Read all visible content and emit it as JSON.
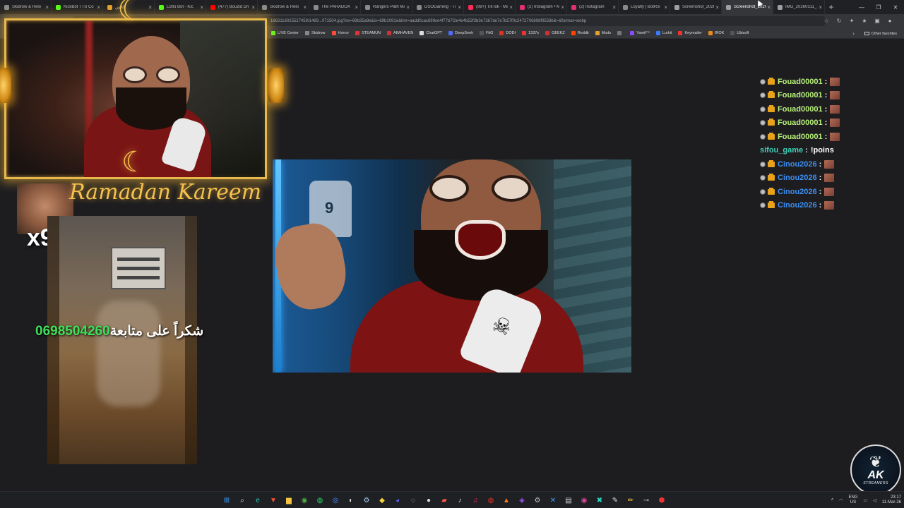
{
  "browser": {
    "tabs": [
      {
        "label": "Skidrow & Relo",
        "color": "#8a8a8a",
        "active": false
      },
      {
        "label": "KickBot TTS Co",
        "color": "#53fc18",
        "active": false
      },
      {
        "label": "كلاس",
        "color": "#e2a12b",
        "active": false
      },
      {
        "label": "Lotto Bot - Kic",
        "color": "#53fc18",
        "active": false
      },
      {
        "label": "(477) Bouzid Dri",
        "color": "#ff0000",
        "active": false
      },
      {
        "label": "Skidrow & Relo",
        "color": "#8a8a8a",
        "active": false
      },
      {
        "label": "The PARADOX",
        "color": "#8a8a8a",
        "active": false
      },
      {
        "label": "Rangers Path Ma",
        "color": "#8a8a8a",
        "active": false
      },
      {
        "label": "DSOGaming - Ti",
        "color": "#8a8a8a",
        "active": false
      },
      {
        "label": "(99+) TikTok - Ma",
        "color": "#ff2a55",
        "active": false
      },
      {
        "label": "(2) Instagram • M",
        "color": "#e1306c",
        "active": false
      },
      {
        "label": "(2) Instagram",
        "color": "#e1306c",
        "active": false
      },
      {
        "label": "Loyalty | BotRix",
        "color": "#8a8a8a",
        "active": false
      },
      {
        "label": "Screenshot_2026",
        "color": "#9aa0a6",
        "active": false
      },
      {
        "label": "Screenshot_2026",
        "color": "#9aa0a6",
        "active": true
      },
      {
        "label": "IMG_20260311_1",
        "color": "#9aa0a6",
        "active": false
      }
    ],
    "new_tab": "+",
    "window_controls": [
      "—",
      "❐",
      "✕"
    ],
    "address": "1662116025527459/1489...071504.jpg?ex=69b25a9e&is=69b1091e&hm=aadd0cac699ce4f77b7f2e4e4b52f3b3e7367de7e7b57f0c2472706898f9558b&=&format=webp",
    "address_prefix": "...dapp.n",
    "bookmarks": [
      {
        "label": "LIVE Center",
        "color": "#53fc18"
      },
      {
        "label": "Skidrow",
        "color": "#888888"
      },
      {
        "label": "Horror",
        "color": "#ff4b3a"
      },
      {
        "label": "STEAMUN",
        "color": "#d33"
      },
      {
        "label": "AIMHAVEN",
        "color": "#c33"
      },
      {
        "label": "ChatGPT",
        "color": "#dddddd"
      },
      {
        "label": "DeepSeek",
        "color": "#4d6bfe"
      },
      {
        "label": "FitG",
        "color": "#555555"
      },
      {
        "label": "DODI",
        "color": "#d32"
      },
      {
        "label": "1337x",
        "color": "#e33"
      },
      {
        "label": "GEEKZ",
        "color": "#c33"
      },
      {
        "label": "Reddit",
        "color": "#ff4500"
      },
      {
        "label": "Mods",
        "color": "#e2a12b"
      },
      {
        "label": "",
        "color": "#777777"
      },
      {
        "label": "Yamil™",
        "color": "#8a4aff"
      },
      {
        "label": "Lurkit",
        "color": "#3a7bfd"
      },
      {
        "label": "Keymailer",
        "color": "#e33"
      },
      {
        "label": "IROK",
        "color": "#e98a1a"
      },
      {
        "label": "Ubisoft",
        "color": "#555555"
      }
    ],
    "other_favorites": "Other favorites"
  },
  "overlay": {
    "ramadan_text": "Ramadan Kareem",
    "multiplier": "x9",
    "thanks_number": "0698504260",
    "thanks_arabic": "شكراً على متابعة"
  },
  "chat": [
    {
      "user": "Fouad00001",
      "msg": "",
      "emote": true,
      "color": "green"
    },
    {
      "user": "Fouad00001",
      "msg": "",
      "emote": true,
      "color": "green"
    },
    {
      "user": "Fouad00001",
      "msg": "",
      "emote": true,
      "color": "green"
    },
    {
      "user": "Fouad00001",
      "msg": "",
      "emote": true,
      "color": "green"
    },
    {
      "user": "Fouad00001",
      "msg": "",
      "emote": true,
      "color": "green"
    },
    {
      "user": "sifou_game",
      "msg": "!poins",
      "emote": false,
      "color": "teal",
      "no_badge": true
    },
    {
      "user": "Cinou2026",
      "msg": "",
      "emote": true,
      "color": "blue"
    },
    {
      "user": "Cinou2026",
      "msg": "",
      "emote": true,
      "color": "blue"
    },
    {
      "user": "Cinou2026",
      "msg": "",
      "emote": true,
      "color": "blue"
    },
    {
      "user": "Cinou2026",
      "msg": "",
      "emote": true,
      "color": "blue"
    }
  ],
  "logo": {
    "title": "AK",
    "subtitle": "STREAMERS"
  },
  "taskbar": {
    "icons": [
      {
        "name": "windows-start-icon",
        "glyph": "⊞",
        "color": "#3aa0ff"
      },
      {
        "name": "search-icon",
        "glyph": "⌕",
        "color": "#dddddd"
      },
      {
        "name": "edge-icon",
        "glyph": "e",
        "color": "#2ec4b6"
      },
      {
        "name": "brave-icon",
        "glyph": "▼",
        "color": "#fb542b"
      },
      {
        "name": "file-explorer-icon",
        "glyph": "▆",
        "color": "#f5c542"
      },
      {
        "name": "xbox-icon",
        "glyph": "◉",
        "color": "#52b043"
      },
      {
        "name": "whatsapp-icon",
        "glyph": "◍",
        "color": "#25d366"
      },
      {
        "name": "browser-icon",
        "glyph": "◎",
        "color": "#4a8cff"
      },
      {
        "name": "obs-icon",
        "glyph": "◐",
        "color": "#dddddd"
      },
      {
        "name": "steam-icon",
        "glyph": "⚙",
        "color": "#9ec7e8"
      },
      {
        "name": "folder-icon",
        "glyph": "◆",
        "color": "#f5d442"
      },
      {
        "name": "discord-icon",
        "glyph": "◕",
        "color": "#5865f2"
      },
      {
        "name": "chrome-icon",
        "glyph": "◌",
        "color": "#dddddd"
      },
      {
        "name": "github-icon",
        "glyph": "●",
        "color": "#dddddd"
      },
      {
        "name": "capture-icon",
        "glyph": "▰",
        "color": "#ff5a4a"
      },
      {
        "name": "music-icon",
        "glyph": "♪",
        "color": "#dddddd"
      },
      {
        "name": "tiktok-icon",
        "glyph": "♫",
        "color": "#ff2a55"
      },
      {
        "name": "record-icon",
        "glyph": "◍",
        "color": "#d32"
      },
      {
        "name": "cloud-icon",
        "glyph": "▲",
        "color": "#ff7a1a"
      },
      {
        "name": "vpn-icon",
        "glyph": "◈",
        "color": "#a050ff"
      },
      {
        "name": "settings-icon",
        "glyph": "⚙",
        "color": "#bbbbbb"
      },
      {
        "name": "vscode-icon",
        "glyph": "✕",
        "color": "#3aa0ff"
      },
      {
        "name": "terminal-icon",
        "glyph": "▤",
        "color": "#dddddd"
      },
      {
        "name": "app-icon",
        "glyph": "◉",
        "color": "#e24aa0"
      },
      {
        "name": "maps-icon",
        "glyph": "✖",
        "color": "#2ed6c8"
      },
      {
        "name": "pen-icon",
        "glyph": "✎",
        "color": "#dddddd"
      },
      {
        "name": "pencil-icon",
        "glyph": "✏",
        "color": "#f5c542"
      },
      {
        "name": "link-icon",
        "glyph": "⊸",
        "color": "#bbbbbb"
      },
      {
        "name": "kick-icon",
        "glyph": "⬢",
        "color": "#e33"
      }
    ],
    "lang_top": "ENG",
    "lang_bottom": "US",
    "time": "23:17",
    "date": "11-Mar-26"
  }
}
